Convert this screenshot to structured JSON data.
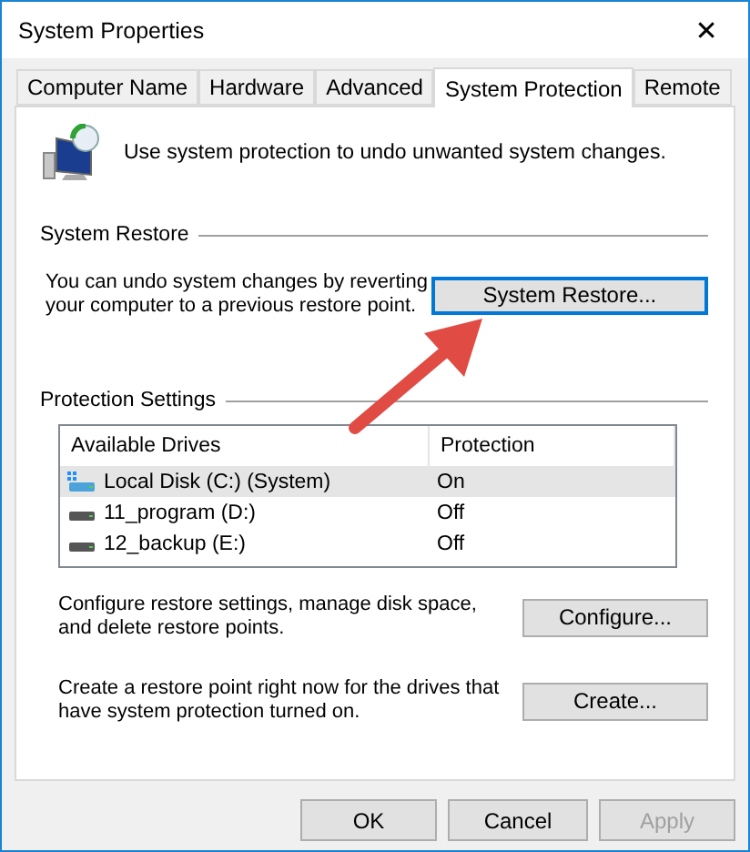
{
  "window": {
    "title": "System Properties",
    "close": "✕"
  },
  "tabs": [
    {
      "label": "Computer Name",
      "selected": false
    },
    {
      "label": "Hardware",
      "selected": false
    },
    {
      "label": "Advanced",
      "selected": false
    },
    {
      "label": "System Protection",
      "selected": true
    },
    {
      "label": "Remote",
      "selected": false
    }
  ],
  "intro": "Use system protection to undo unwanted system changes.",
  "system_restore": {
    "heading": "System Restore",
    "text": "You can undo system changes by reverting your computer to a previous restore point.",
    "button": {
      "label": "System Restore...",
      "focused": true
    }
  },
  "protection_settings": {
    "heading": "Protection Settings",
    "columns": [
      "Available Drives",
      "Protection"
    ],
    "rows": [
      {
        "kind": "system",
        "drive": "Local Disk (C:) (System)",
        "protection": "On",
        "selected": true
      },
      {
        "kind": "drive",
        "drive": "11_program (D:)",
        "protection": "Off",
        "selected": false
      },
      {
        "kind": "drive",
        "drive": "12_backup (E:)",
        "protection": "Off",
        "selected": false
      }
    ],
    "actions": [
      {
        "text": "Configure restore settings, manage disk space, and delete restore points.",
        "button": "Configure..."
      },
      {
        "text": "Create a restore point right now for the drives that have system protection turned on.",
        "button": "Create..."
      }
    ]
  },
  "buttons": [
    {
      "label": "OK",
      "disabled": false
    },
    {
      "label": "Cancel",
      "disabled": false
    },
    {
      "label": "Apply",
      "disabled": true
    }
  ]
}
